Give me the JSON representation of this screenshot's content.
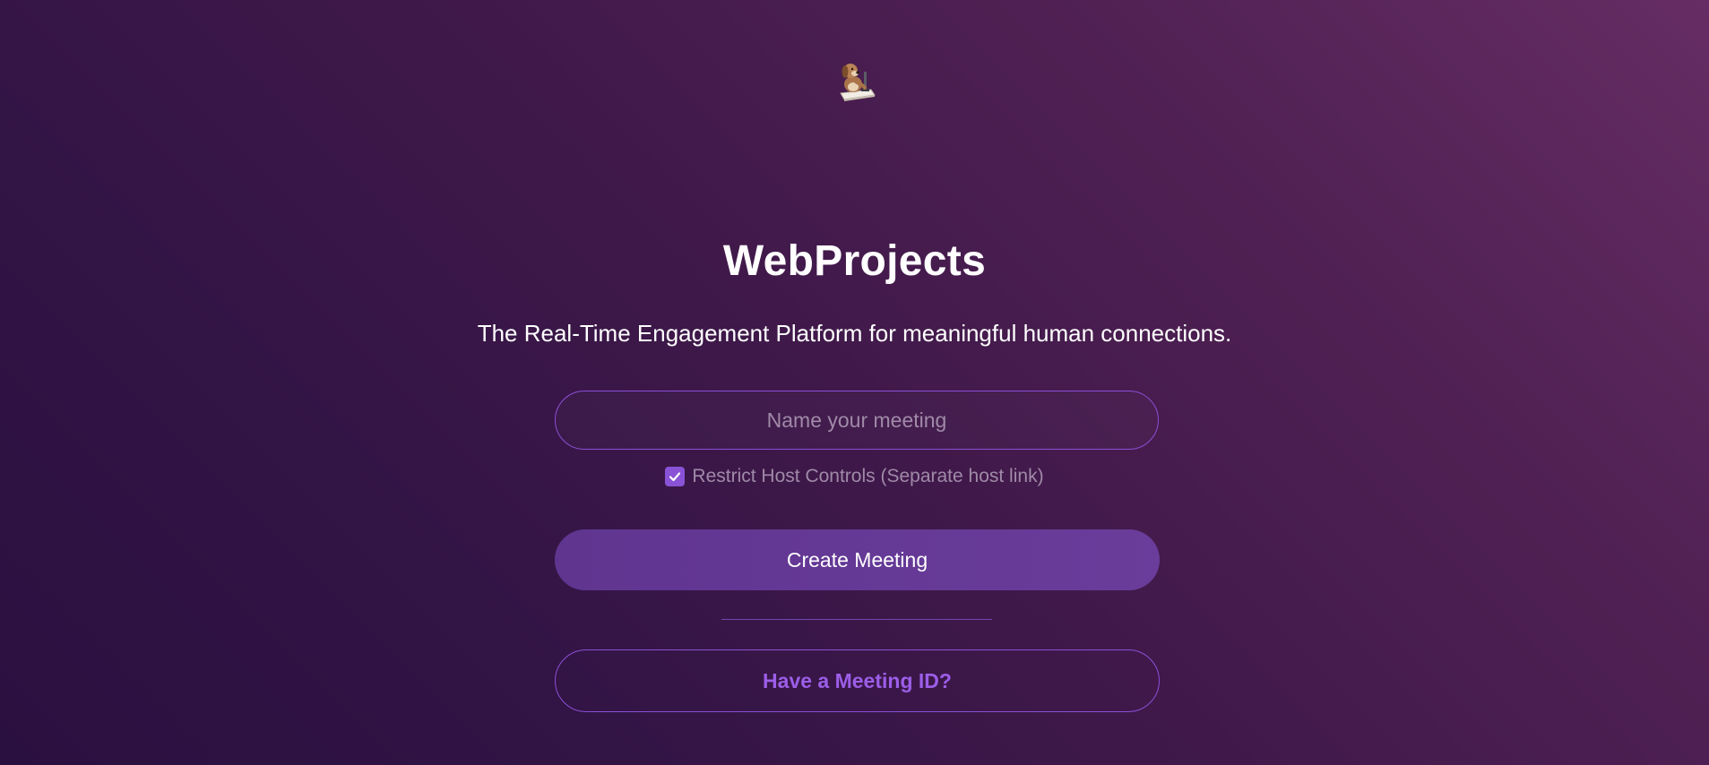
{
  "app": {
    "logo_icon": "dog-at-computer-icon",
    "title": "WebProjects",
    "tagline": "The Real-Time Engagement Platform for meaningful human connections."
  },
  "form": {
    "name_input": {
      "value": "",
      "placeholder": "Name your meeting"
    },
    "restrict_host_controls": {
      "checked": true,
      "label": "Restrict Host Controls (Separate host link)"
    },
    "create_button_label": "Create Meeting",
    "meeting_id_button_label": "Have a Meeting ID?"
  },
  "colors": {
    "accent": "#8a52d6",
    "primary_button": "#643899",
    "link_text": "#9c5ee8",
    "background_dark": "#2a1040",
    "background_light": "#652d63"
  }
}
